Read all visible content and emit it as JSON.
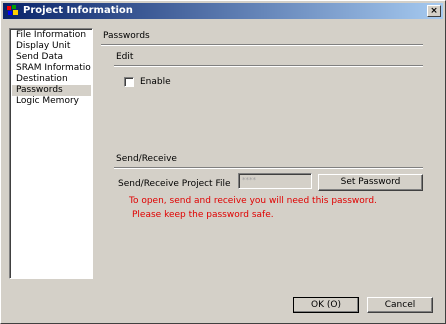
{
  "window": {
    "title": "Project Information",
    "close_label": "×"
  },
  "nav": {
    "items": [
      {
        "label": "File Information"
      },
      {
        "label": "Display Unit"
      },
      {
        "label": "Send Data"
      },
      {
        "label": "SRAM Information"
      },
      {
        "label": "Destination"
      },
      {
        "label": "Passwords"
      },
      {
        "label": "Logic Memory"
      }
    ],
    "selected": "Passwords"
  },
  "panel": {
    "title": "Passwords",
    "edit_section": {
      "label": "Edit",
      "enable_label": "Enable",
      "enable_checked": false
    },
    "send_receive_section": {
      "label": "Send/Receive",
      "field_label": "Send/Receive Project File",
      "password_value": "****",
      "set_password_label": "Set Password",
      "warning_line1": "To open, send and receive you will need this password.",
      "warning_line2": "Please keep the password safe."
    }
  },
  "footer": {
    "ok_label": "OK (O)",
    "cancel_label": "Cancel"
  },
  "colors": {
    "titlebar_start": "#0a246a",
    "titlebar_end": "#a6caf0",
    "warning_text": "#e00000",
    "window_bg": "#d4d0c8"
  }
}
